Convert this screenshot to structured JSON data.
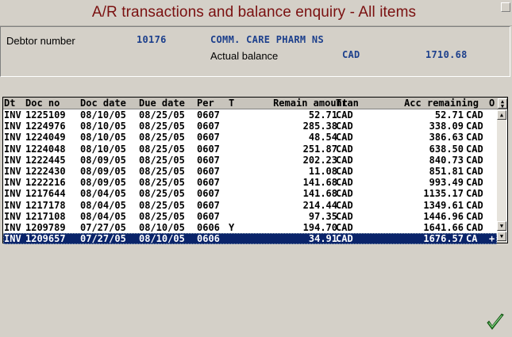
{
  "window": {
    "title": "A/R transactions and balance enquiry - All items"
  },
  "header": {
    "debtor_label": "Debtor number",
    "debtor_number": "10176",
    "debtor_name": "COMM. CARE PHARM NS",
    "balance_label": "Actual balance",
    "balance_currency": "CAD",
    "balance_amount": "1710.68"
  },
  "grid": {
    "columns": {
      "dt": "Dt",
      "doc_no": "Doc no",
      "doc_date": "Doc date",
      "due_date": "Due date",
      "per": "Per",
      "t": "T",
      "remain_amount": "Remain amount",
      "tran": "Tran",
      "acc_remaining": "Acc remaining",
      "o": "O"
    },
    "rows": [
      {
        "dt": "INV",
        "doc_no": "1225109",
        "doc_date": "08/10/05",
        "due_date": "08/25/05",
        "per": "0607",
        "t": "",
        "remain": "52.71",
        "tran": "CAD",
        "acc": "52.71",
        "cur": "CAD",
        "flag": ""
      },
      {
        "dt": "INV",
        "doc_no": "1224976",
        "doc_date": "08/10/05",
        "due_date": "08/25/05",
        "per": "0607",
        "t": "",
        "remain": "285.38",
        "tran": "CAD",
        "acc": "338.09",
        "cur": "CAD",
        "flag": ""
      },
      {
        "dt": "INV",
        "doc_no": "1224049",
        "doc_date": "08/10/05",
        "due_date": "08/25/05",
        "per": "0607",
        "t": "",
        "remain": "48.54",
        "tran": "CAD",
        "acc": "386.63",
        "cur": "CAD",
        "flag": ""
      },
      {
        "dt": "INV",
        "doc_no": "1224048",
        "doc_date": "08/10/05",
        "due_date": "08/25/05",
        "per": "0607",
        "t": "",
        "remain": "251.87",
        "tran": "CAD",
        "acc": "638.50",
        "cur": "CAD",
        "flag": ""
      },
      {
        "dt": "INV",
        "doc_no": "1222445",
        "doc_date": "08/09/05",
        "due_date": "08/25/05",
        "per": "0607",
        "t": "",
        "remain": "202.23",
        "tran": "CAD",
        "acc": "840.73",
        "cur": "CAD",
        "flag": ""
      },
      {
        "dt": "INV",
        "doc_no": "1222430",
        "doc_date": "08/09/05",
        "due_date": "08/25/05",
        "per": "0607",
        "t": "",
        "remain": "11.08",
        "tran": "CAD",
        "acc": "851.81",
        "cur": "CAD",
        "flag": ""
      },
      {
        "dt": "INV",
        "doc_no": "1222216",
        "doc_date": "08/09/05",
        "due_date": "08/25/05",
        "per": "0607",
        "t": "",
        "remain": "141.68",
        "tran": "CAD",
        "acc": "993.49",
        "cur": "CAD",
        "flag": ""
      },
      {
        "dt": "INV",
        "doc_no": "1217644",
        "doc_date": "08/04/05",
        "due_date": "08/25/05",
        "per": "0607",
        "t": "",
        "remain": "141.68",
        "tran": "CAD",
        "acc": "1135.17",
        "cur": "CAD",
        "flag": ""
      },
      {
        "dt": "INV",
        "doc_no": "1217178",
        "doc_date": "08/04/05",
        "due_date": "08/25/05",
        "per": "0607",
        "t": "",
        "remain": "214.44",
        "tran": "CAD",
        "acc": "1349.61",
        "cur": "CAD",
        "flag": ""
      },
      {
        "dt": "INV",
        "doc_no": "1217108",
        "doc_date": "08/04/05",
        "due_date": "08/25/05",
        "per": "0607",
        "t": "",
        "remain": "97.35",
        "tran": "CAD",
        "acc": "1446.96",
        "cur": "CAD",
        "flag": ""
      },
      {
        "dt": "INV",
        "doc_no": "1209789",
        "doc_date": "07/27/05",
        "due_date": "08/10/05",
        "per": "0606",
        "t": "Y",
        "remain": "194.70",
        "tran": "CAD",
        "acc": "1641.66",
        "cur": "CAD",
        "flag": ""
      },
      {
        "dt": "INV",
        "doc_no": "1209657",
        "doc_date": "07/27/05",
        "due_date": "08/10/05",
        "per": "0606",
        "t": "",
        "remain": "34.91",
        "tran": "CAD",
        "acc": "1676.57",
        "cur": "CA",
        "flag": "+",
        "selected": true
      }
    ]
  },
  "icons": {
    "ok": "checkmark-icon",
    "sort": "sort-arrows-icon",
    "scroll_up": "arrow-up-icon",
    "scroll_down": "arrow-down-icon"
  },
  "colors": {
    "title": "#7a1010",
    "header_values": "#1c3f8c",
    "selection": "#0a246a",
    "ok_green": "#2e8b2e"
  }
}
